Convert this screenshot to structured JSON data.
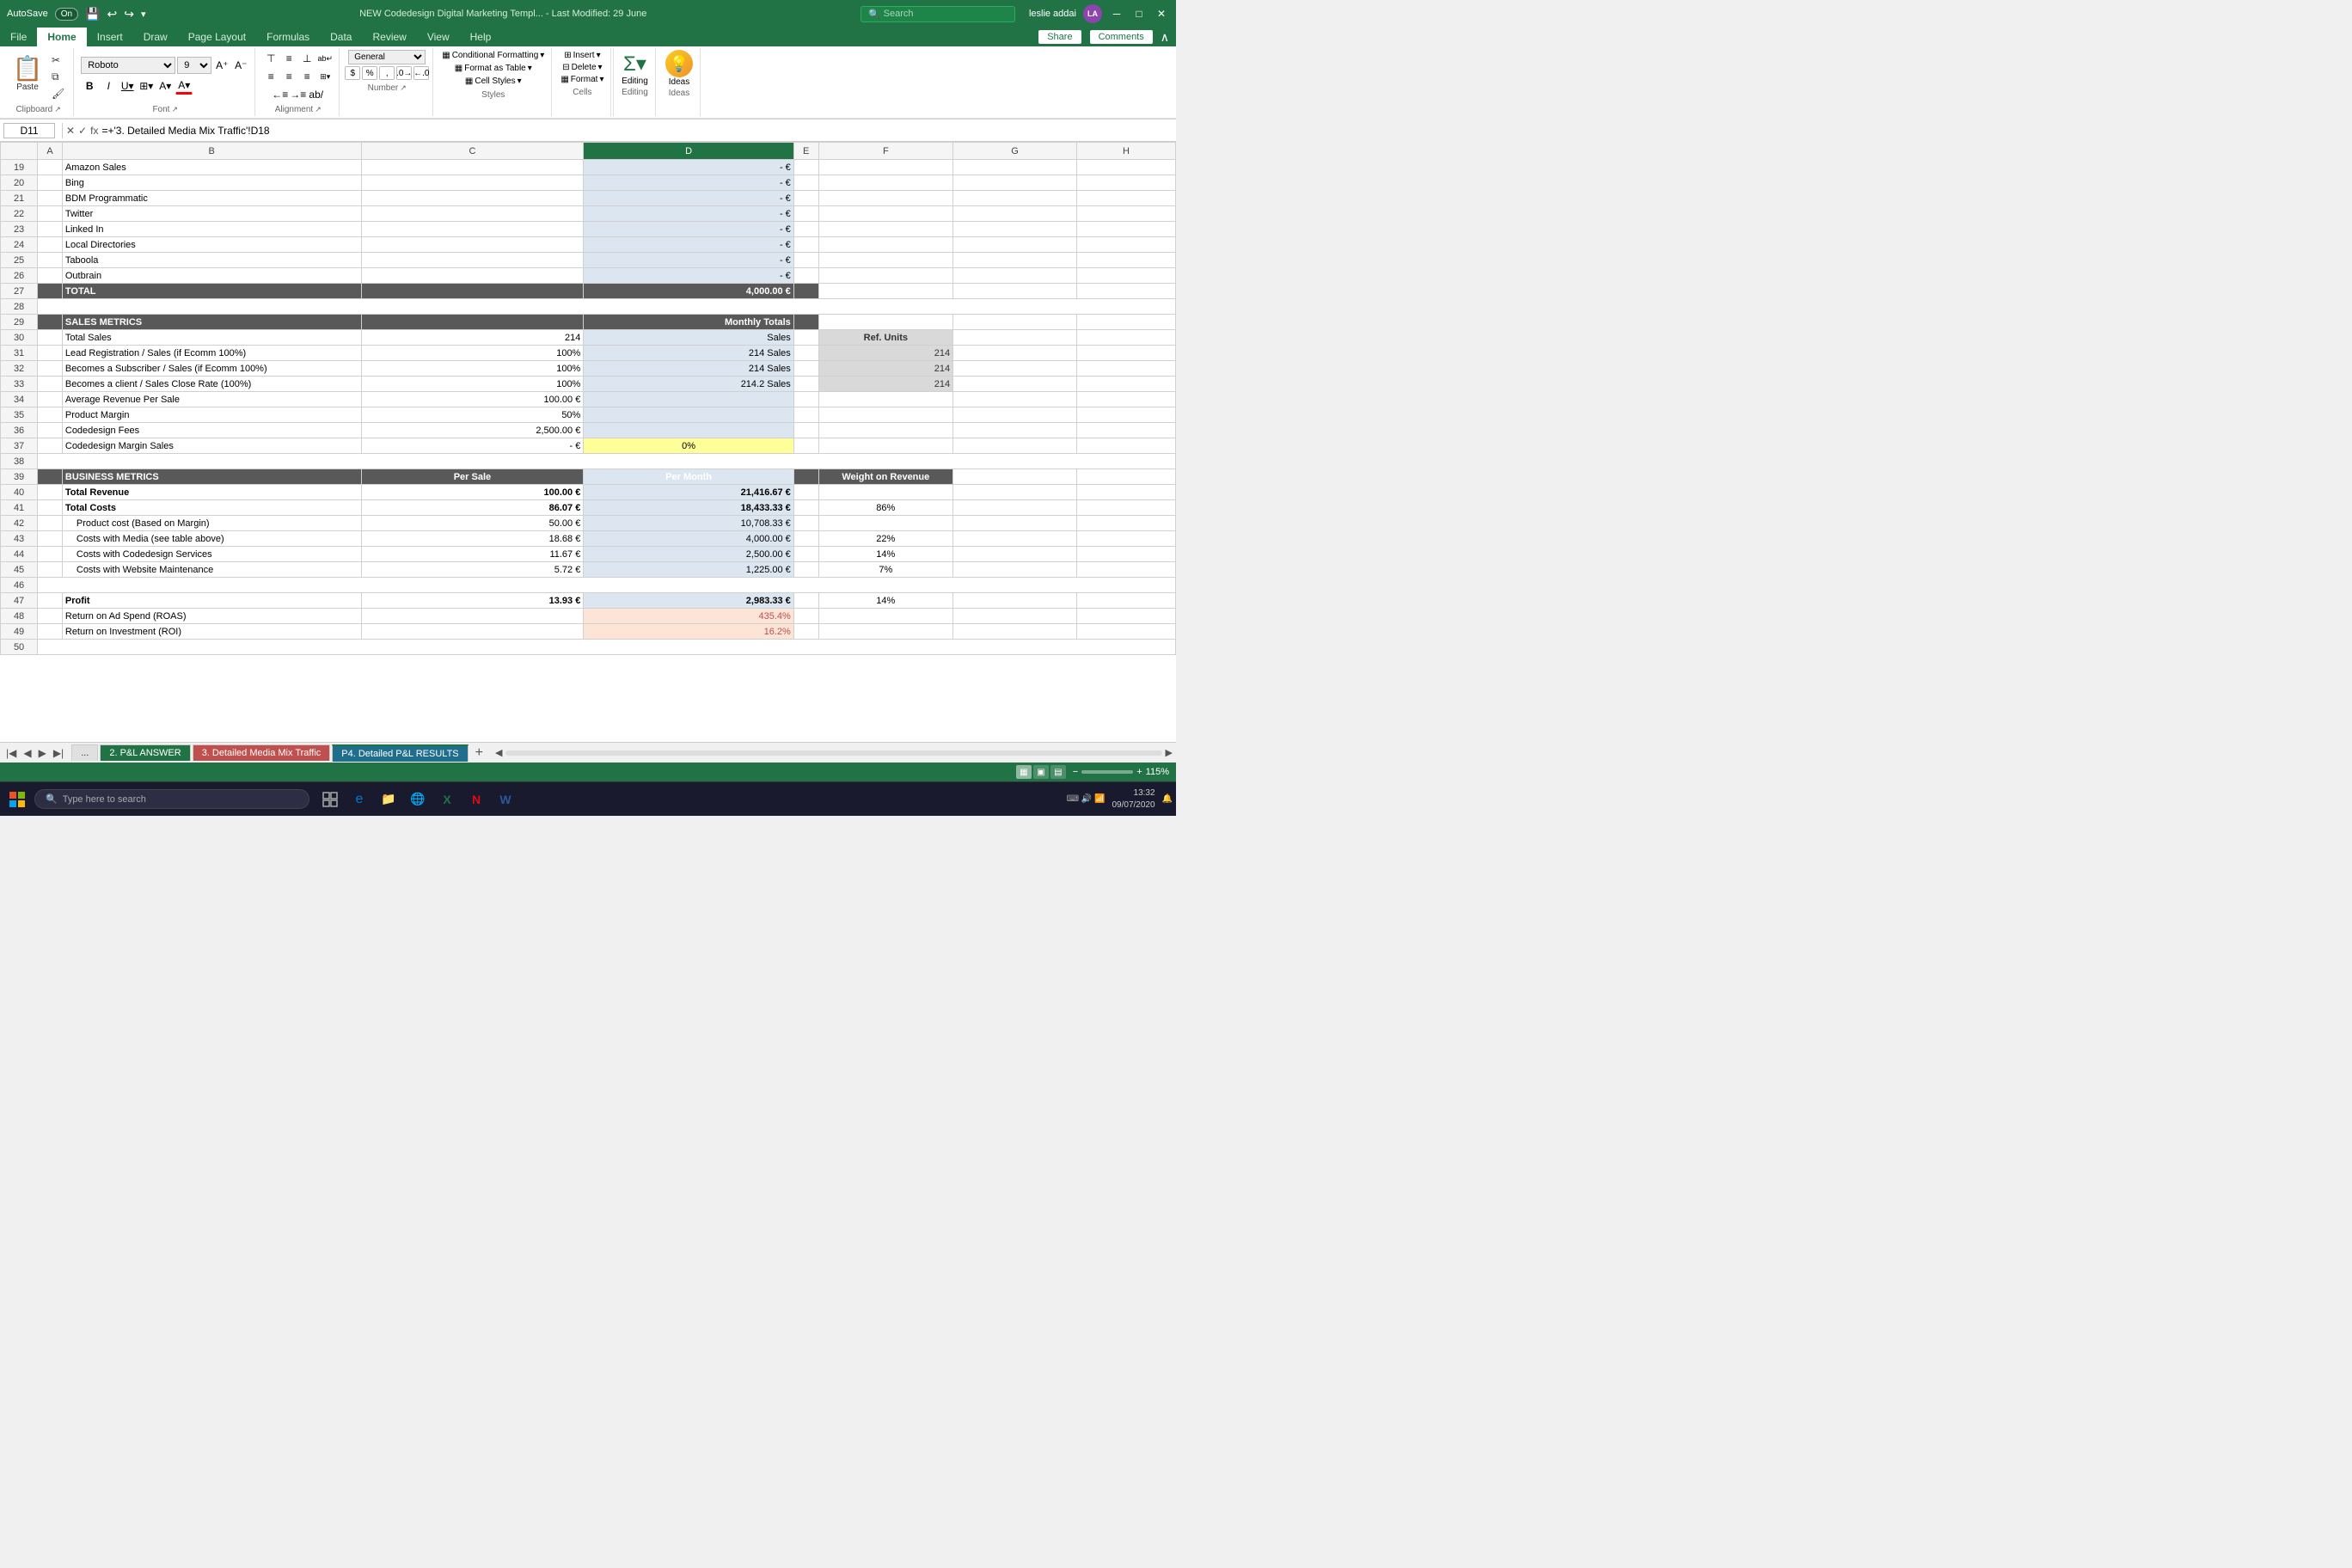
{
  "titlebar": {
    "autosave_label": "AutoSave",
    "autosave_state": "On",
    "title": "NEW Codedesign Digital Marketing Templ... - Last Modified: 29 June",
    "search_placeholder": "Search",
    "user_name": "leslie addai",
    "user_initials": "LA"
  },
  "ribbon": {
    "tabs": [
      "File",
      "Home",
      "Insert",
      "Draw",
      "Page Layout",
      "Formulas",
      "Data",
      "Review",
      "View",
      "Help"
    ],
    "active_tab": "Home",
    "share_label": "Share",
    "comments_label": "Comments",
    "groups": {
      "clipboard": "Clipboard",
      "font": "Font",
      "alignment": "Alignment",
      "number": "Number",
      "styles": "Styles",
      "cells": "Cells",
      "editing": "Editing",
      "ideas": "Ideas"
    },
    "font_name": "Roboto",
    "font_size": "9",
    "editing_label": "Editing",
    "format_label": "Format",
    "ideas_label": "Ideas",
    "cell_styles_label": "Cell Styles",
    "format_as_table_label": "Format as Table",
    "conditional_formatting_label": "Conditional Formatting",
    "insert_label": "Insert",
    "delete_label": "Delete",
    "format_cells_label": "Format"
  },
  "formula_bar": {
    "cell_ref": "D11",
    "formula": "=+'3. Detailed Media Mix Traffic'!D18"
  },
  "spreadsheet": {
    "col_headers": [
      "",
      "A",
      "B",
      "C",
      "D",
      "E",
      "F",
      "G",
      "H"
    ],
    "rows": [
      {
        "row": 19,
        "cells": [
          "",
          "Amazon Sales",
          "",
          "",
          "- €",
          ""
        ]
      },
      {
        "row": 20,
        "cells": [
          "",
          "Bing",
          "",
          "",
          "- €",
          ""
        ]
      },
      {
        "row": 21,
        "cells": [
          "",
          "BDM Programmatic",
          "",
          "",
          "- €",
          ""
        ]
      },
      {
        "row": 22,
        "cells": [
          "",
          "Twitter",
          "",
          "",
          "- €",
          ""
        ]
      },
      {
        "row": 23,
        "cells": [
          "",
          "Linked In",
          "",
          "",
          "- €",
          ""
        ]
      },
      {
        "row": 24,
        "cells": [
          "",
          "Local Directories",
          "",
          "",
          "- €",
          ""
        ]
      },
      {
        "row": 25,
        "cells": [
          "",
          "Taboola",
          "",
          "",
          "- €",
          ""
        ]
      },
      {
        "row": 26,
        "cells": [
          "",
          "Outbrain",
          "",
          "",
          "- €",
          ""
        ]
      },
      {
        "row": 27,
        "cells": [
          "",
          "TOTAL",
          "",
          "",
          "4,000.00 €",
          ""
        ],
        "style": "total"
      },
      {
        "row": 28,
        "cells": [
          "",
          "",
          "",
          "",
          "",
          ""
        ]
      },
      {
        "row": 29,
        "cells": [
          "",
          "SALES METRICS",
          "",
          "Monthly Totals",
          "",
          ""
        ],
        "style": "dark-header"
      },
      {
        "row": 30,
        "cells": [
          "",
          "Total Sales",
          "",
          "214",
          "Sales",
          "Ref. Units"
        ]
      },
      {
        "row": 31,
        "cells": [
          "",
          "Lead Registration / Sales (if Ecomm 100%)",
          "",
          "100%",
          "214 Sales",
          "214"
        ]
      },
      {
        "row": 32,
        "cells": [
          "",
          "Becomes a Subscriber / Sales (if Ecomm 100%)",
          "",
          "100%",
          "214 Sales",
          "214"
        ]
      },
      {
        "row": 33,
        "cells": [
          "",
          "Becomes a client / Sales Close Rate (100%)",
          "",
          "100%",
          "214.2 Sales",
          "214"
        ]
      },
      {
        "row": 34,
        "cells": [
          "",
          "Average Revenue Per Sale",
          "",
          "100.00 €",
          "",
          ""
        ]
      },
      {
        "row": 35,
        "cells": [
          "",
          "Product Margin",
          "",
          "50%",
          "",
          ""
        ]
      },
      {
        "row": 36,
        "cells": [
          "",
          "Codedesign Fees",
          "",
          "2,500.00 €",
          "",
          ""
        ]
      },
      {
        "row": 37,
        "cells": [
          "",
          "Codedesign Margin Sales",
          "",
          "- €",
          "0%",
          ""
        ],
        "style": "yellow"
      },
      {
        "row": 38,
        "cells": [
          "",
          "",
          "",
          "",
          "",
          ""
        ]
      },
      {
        "row": 39,
        "cells": [
          "",
          "BUSINESS METRICS",
          "Per Sale",
          "Per Month",
          "",
          "Weight on Revenue"
        ],
        "style": "dark-header"
      },
      {
        "row": 40,
        "cells": [
          "",
          "Total Revenue",
          "100.00 €",
          "21,416.67 €",
          "",
          ""
        ],
        "style": "bold"
      },
      {
        "row": 41,
        "cells": [
          "",
          "Total Costs",
          "86.07 €",
          "18,433.33 €",
          "",
          "86%"
        ],
        "style": "bold"
      },
      {
        "row": 42,
        "cells": [
          "",
          "Product cost (Based on Margin)",
          "50.00 €",
          "10,708.33 €",
          "",
          ""
        ],
        "style": "indent"
      },
      {
        "row": 43,
        "cells": [
          "",
          "Costs with Media (see table above)",
          "18.68 €",
          "4,000.00 €",
          "",
          "22%"
        ],
        "style": "indent"
      },
      {
        "row": 44,
        "cells": [
          "",
          "Costs with Codedesign Services",
          "11.67 €",
          "2,500.00 €",
          "",
          "14%"
        ],
        "style": "indent"
      },
      {
        "row": 45,
        "cells": [
          "",
          "Costs with Website Maintenance",
          "5.72 €",
          "1,225.00 €",
          "",
          "7%"
        ],
        "style": "indent"
      },
      {
        "row": 46,
        "cells": [
          "",
          "",
          "",
          "",
          "",
          ""
        ]
      },
      {
        "row": 47,
        "cells": [
          "",
          "Profit",
          "13.93 €",
          "2,983.33 €",
          "",
          "14%"
        ],
        "style": "bold"
      },
      {
        "row": 48,
        "cells": [
          "",
          "Return on Ad Spend (ROAS)",
          "",
          "435.4%",
          "",
          ""
        ],
        "style": "orange-light"
      },
      {
        "row": 49,
        "cells": [
          "",
          "Return on Investment (ROI)",
          "",
          "16.2%",
          "",
          ""
        ],
        "style": "orange-light"
      },
      {
        "row": 50,
        "cells": [
          "",
          "",
          "",
          "",
          "",
          ""
        ]
      }
    ]
  },
  "sheet_tabs": [
    {
      "label": "...",
      "style": "nav"
    },
    {
      "label": "2. P&L ANSWER",
      "style": "green"
    },
    {
      "label": "3. Detailed Media Mix Traffic",
      "style": "red"
    },
    {
      "label": "P4. Detailed P&L RESULTS",
      "style": "teal",
      "active": true
    }
  ],
  "status_bar": {
    "zoom": "115%"
  },
  "taskbar": {
    "search_placeholder": "Type here to search",
    "time": "13:32",
    "date": "09/07/2020"
  }
}
